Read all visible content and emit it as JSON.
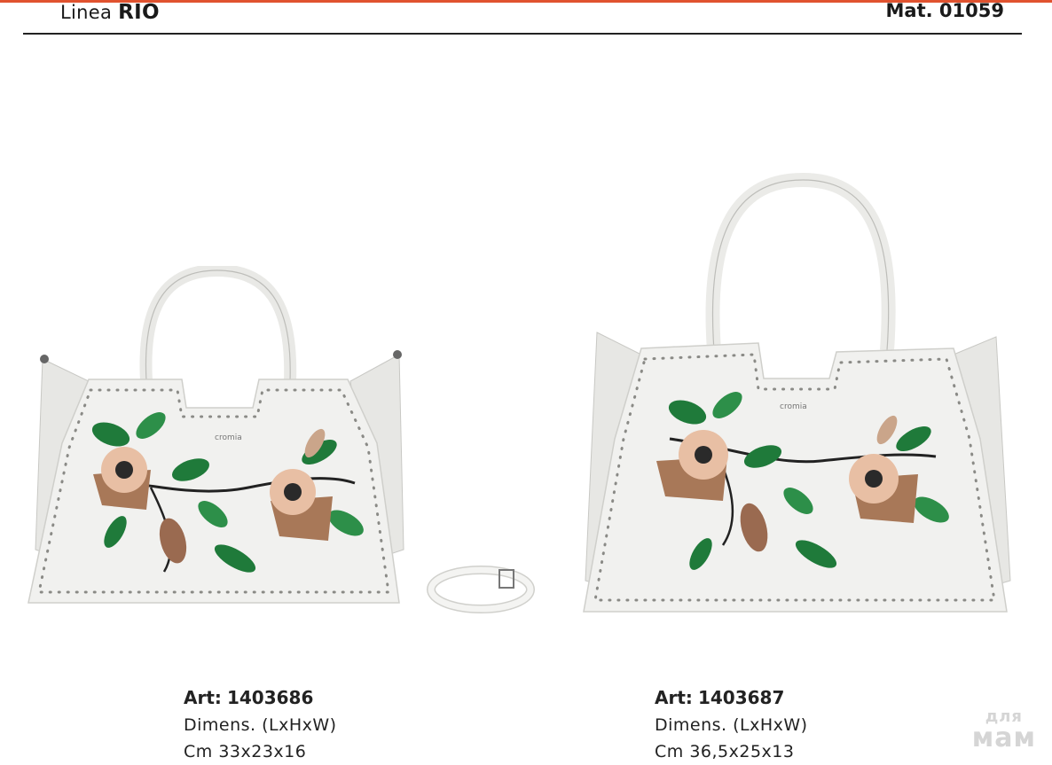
{
  "header": {
    "line_prefix": "Linea",
    "line_name": "RIO",
    "material": "Mat. 01059"
  },
  "products": [
    {
      "art_label": "Art:",
      "art_number": "1403686",
      "dims_label": "Dimens. (LxHxW)",
      "dims_value": "Cm 33x23x16",
      "logo_text": "cromia"
    },
    {
      "art_label": "Art:",
      "art_number": "1403687",
      "dims_label": "Dimens. (LxHxW)",
      "dims_value": "Cm 36,5x25x13",
      "logo_text": "cromia"
    }
  ],
  "watermark": {
    "line1": "для",
    "line2": "мам"
  },
  "colors": {
    "accent": "#e0522f",
    "bag": "#f1f1ef",
    "leaf": "#1f7a3a",
    "petal": "#c79a7d"
  }
}
